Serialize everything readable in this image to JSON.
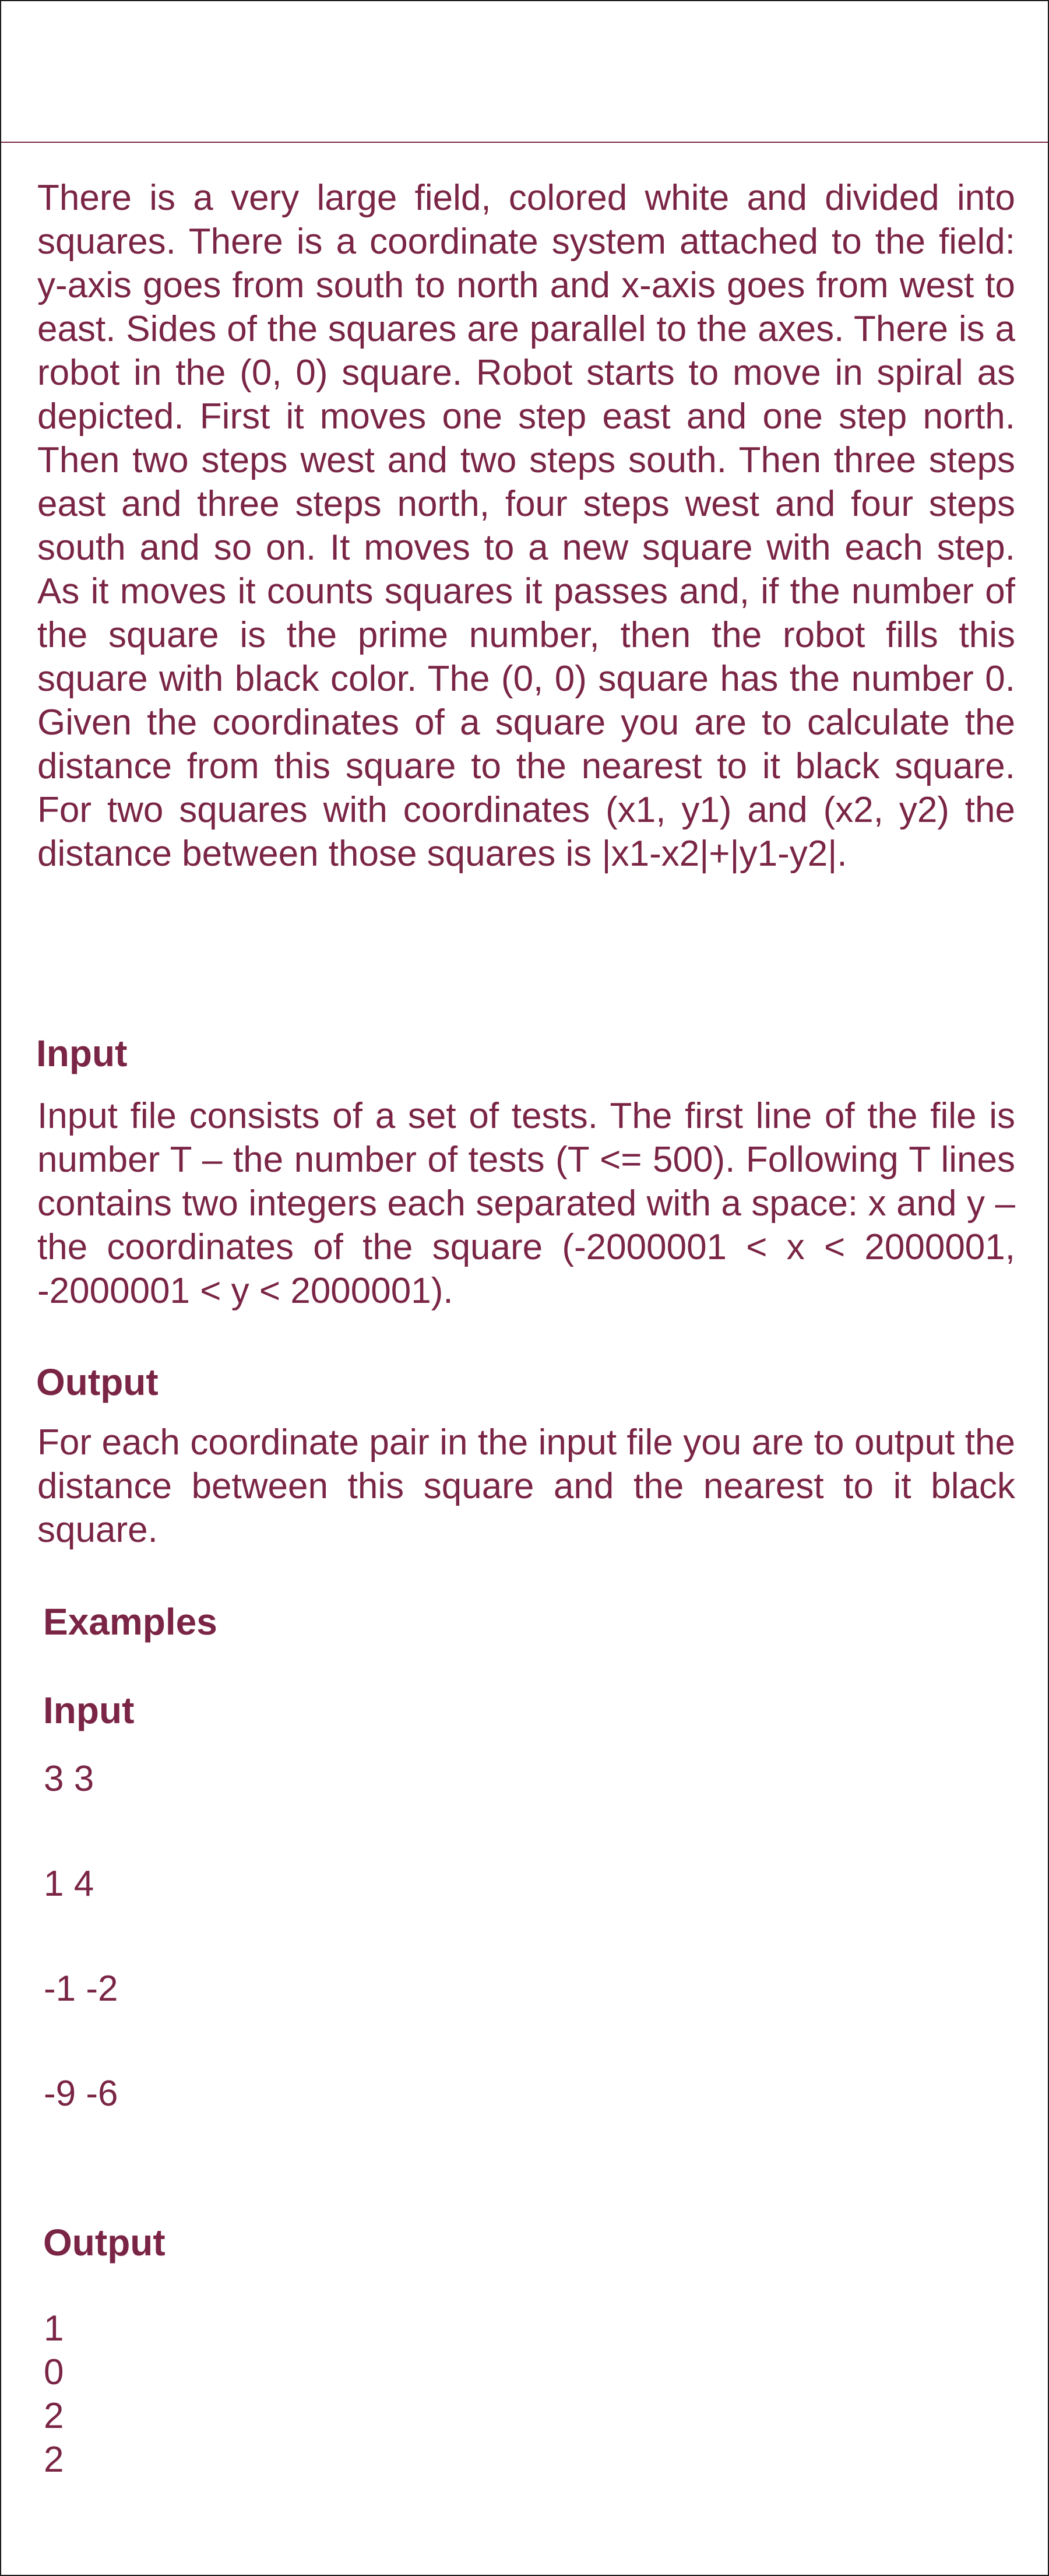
{
  "statement": "There is a very large field, colored white and divided into squares. There is a coordinate system attached to the field: y-axis goes from south to north and x-axis goes from west to east. Sides of the squares are parallel to the axes. There is a robot in the (0, 0) square. Robot starts to move in spiral as depicted. First it moves one step east and one step north. Then two steps west and two steps south. Then three steps east and three steps north, four steps west and four steps south and so on. It moves to a new square with each step. As it moves it counts squares it passes and, if the number of the square is the prime number, then the robot fills this square with black color. The (0, 0) square has the number 0. Given the coordinates of a square you are to calculate the distance from this square to the nearest to it black square. For two squares with coordinates (x1, y1) and (x2, y2) the distance between those squares is |x1-x2|+|y1-y2|.",
  "input_section": {
    "heading": "Input",
    "text": "Input file consists of a set of tests. The first line of the file is number T – the number of tests (T <= 500). Following T lines contains two integers each separated with a space: x and y – the coordinates of the square (-2000001 < x < 2000001, -2000001 < y < 2000001)."
  },
  "output_section": {
    "heading": "Output",
    "text": "For each coordinate pair in the input file you are to output the distance between this square and the nearest to it black square."
  },
  "examples": {
    "heading": "Examples",
    "input_label": "Input",
    "input_lines": [
      "3 3",
      "1 4",
      "-1 -2",
      "-9 -6"
    ],
    "output_label": "Output",
    "output_lines": [
      "1",
      "0",
      "2",
      "2"
    ]
  }
}
